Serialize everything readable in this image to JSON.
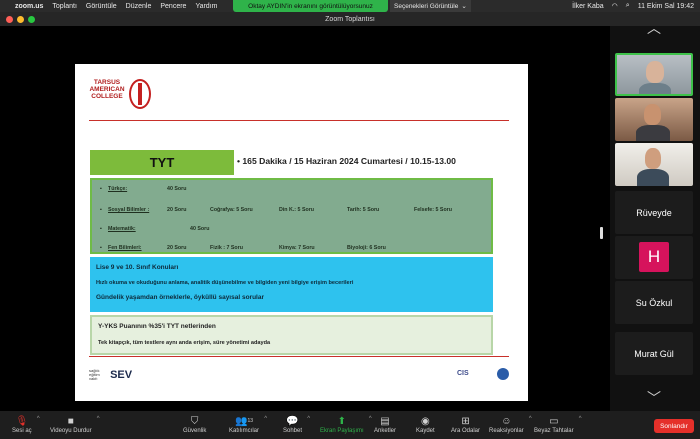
{
  "menubar": {
    "app": "zoom.us",
    "items": [
      "Toplantı",
      "Görüntüle",
      "Düzenle",
      "Pencere",
      "Yardım"
    ],
    "share_banner": "Oktay AYDIN'in ekranını görüntülüyorsunuz",
    "view_options": "Seçenekleri Görüntüle",
    "user": "İlker Kaba",
    "datetime": "11 Ekim Sal 19:42"
  },
  "window": {
    "title": "Zoom Toplantısı"
  },
  "slide": {
    "logo_text": "TARSUS AMERICAN COLLEGE",
    "tyt_label": "TYT",
    "date_line": "• 165 Dakika / 15 Haziran 2024 Cumartesi / 10.15-13.00",
    "rows": {
      "turkce": {
        "label": "Türkçe:",
        "count": "40 Soru"
      },
      "sosyal": {
        "label": "Sosyal Bilimler :",
        "count": "20 Soru",
        "cografya": "Coğrafya: 5 Soru",
        "din": "Din K.: 5 Soru",
        "tarih": "Tarih: 5 Soru",
        "felsefe": "Felsefe: 5 Soru"
      },
      "matematik": {
        "label": "Matematik:",
        "count": "40 Soru"
      },
      "fen": {
        "label": "Fen Bilimleri:",
        "count": "20 Soru",
        "fizik": "Fizik : 7 Soru",
        "kimya": "Kimya: 7 Soru",
        "biyoloji": "Biyoloji: 6 Soru"
      }
    },
    "cyan": {
      "heading": "Lise 9 ve 10. Sınıf Konuları",
      "line1": "Hızlı okuma ve okuduğunu anlama, analitik düşünebilme ve bilgiden yeni bilgiye erişim becerileri",
      "line2": "Gündelik yaşamdan örneklerle, öyküllü sayısal sorular"
    },
    "pale": {
      "heading": "Y-YKS Puanının %35'i TYT netlerinden",
      "line1": "Tek kitapçık, tüm testlere aynı anda erişim, süre yönetimi adayda"
    },
    "footer_left": "SEV",
    "footer_left_small": "sağlık eğitim vakfı",
    "footer_right": "CIS"
  },
  "participants": [
    "Rüveyde",
    "H",
    "Su Özkul",
    "Murat Gül"
  ],
  "toolbar": {
    "mic": "Sesi aç",
    "video": "Videoyu Durdur",
    "security": "Güvenlik",
    "participants": "Katılımcılar",
    "participants_count": "13",
    "chat": "Sohbet",
    "share": "Ekran Paylaşımı",
    "polls": "Anketler",
    "record": "Kaydet",
    "breakout": "Ara Odalar",
    "reactions": "Reaksiyonlar",
    "whiteboards": "Beyaz Tahtalar",
    "end": "Sonlandır"
  },
  "colors": {
    "share_green": "#2fb34a",
    "end_red": "#e5302a",
    "tyt_green": "#7dbb3b",
    "cyan": "#2ec2ee"
  }
}
